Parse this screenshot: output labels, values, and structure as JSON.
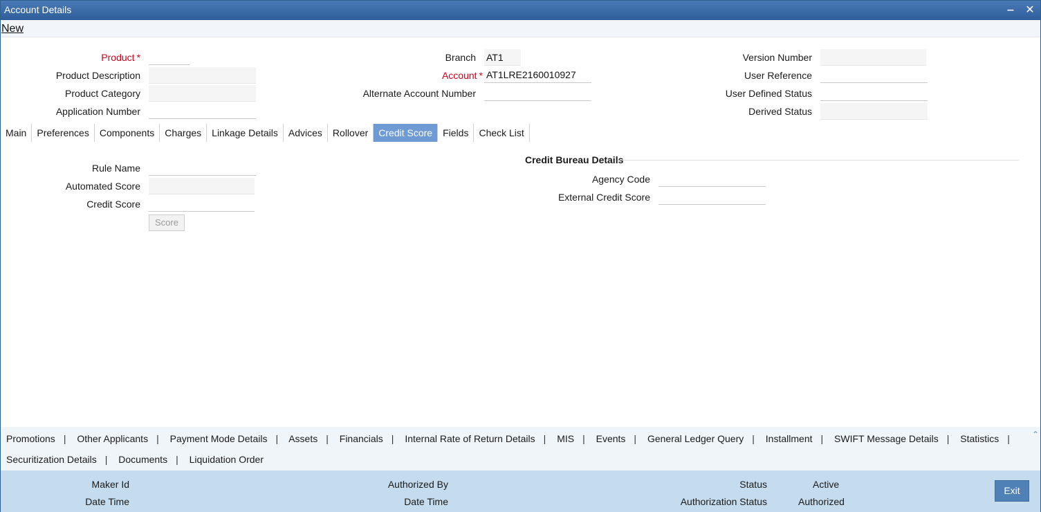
{
  "window": {
    "title": "Account Details"
  },
  "toolbar": {
    "new_label": "New"
  },
  "header": {
    "product_label": "Product",
    "product_value": "",
    "product_description_label": "Product Description",
    "product_description_value": "",
    "product_category_label": "Product Category",
    "product_category_value": "",
    "application_number_label": "Application Number",
    "application_number_value": "",
    "branch_label": "Branch",
    "branch_value": "AT1",
    "account_label": "Account",
    "account_value": "AT1LRE2160010927",
    "alternate_account_label": "Alternate Account Number",
    "alternate_account_value": "",
    "version_number_label": "Version Number",
    "version_number_value": "",
    "user_reference_label": "User Reference",
    "user_reference_value": "",
    "user_defined_status_label": "User Defined Status",
    "user_defined_status_value": "",
    "derived_status_label": "Derived Status",
    "derived_status_value": "",
    "required_marker": "*"
  },
  "tabs": [
    {
      "label": "Main"
    },
    {
      "label": "Preferences"
    },
    {
      "label": "Components"
    },
    {
      "label": "Charges"
    },
    {
      "label": "Linkage Details"
    },
    {
      "label": "Advices"
    },
    {
      "label": "Rollover"
    },
    {
      "label": "Credit Score"
    },
    {
      "label": "Fields"
    },
    {
      "label": "Check List"
    }
  ],
  "active_tab": "Credit Score",
  "credit_score": {
    "rule_name_label": "Rule Name",
    "rule_name_value": "",
    "automated_score_label": "Automated Score",
    "automated_score_value": "",
    "credit_score_label": "Credit Score",
    "credit_score_value": "",
    "score_button": "Score"
  },
  "credit_bureau": {
    "title": "Credit Bureau Details",
    "agency_code_label": "Agency Code",
    "agency_code_value": "",
    "external_credit_score_label": "External Credit Score",
    "external_credit_score_value": ""
  },
  "subsystems": {
    "row1": [
      "Promotions",
      "Other Applicants",
      "Payment Mode Details",
      "Assets",
      "Financials",
      "Internal Rate of Return Details",
      "MIS",
      "Events",
      "General Ledger Query",
      "Installment",
      "SWIFT Message Details",
      "Statistics"
    ],
    "row2": [
      "Securitization Details",
      "Documents",
      "Liquidation Order"
    ],
    "separator": "|"
  },
  "audit": {
    "maker_id_label": "Maker Id",
    "maker_id_value": "",
    "maker_date_time_label": "Date Time",
    "maker_date_time_value": "",
    "authorized_by_label": "Authorized By",
    "authorized_by_value": "",
    "checker_date_time_label": "Date Time",
    "checker_date_time_value": "",
    "status_label": "Status",
    "status_value": "Active",
    "authorization_status_label": "Authorization Status",
    "authorization_status_value": "Authorized",
    "exit_button": "Exit"
  },
  "colors": {
    "titlebar": "#2f5f9a",
    "active_tab": "#6f9bd4",
    "required": "#d0021b",
    "audit_bg": "#c4dcee",
    "exit_button": "#4f80b6"
  }
}
